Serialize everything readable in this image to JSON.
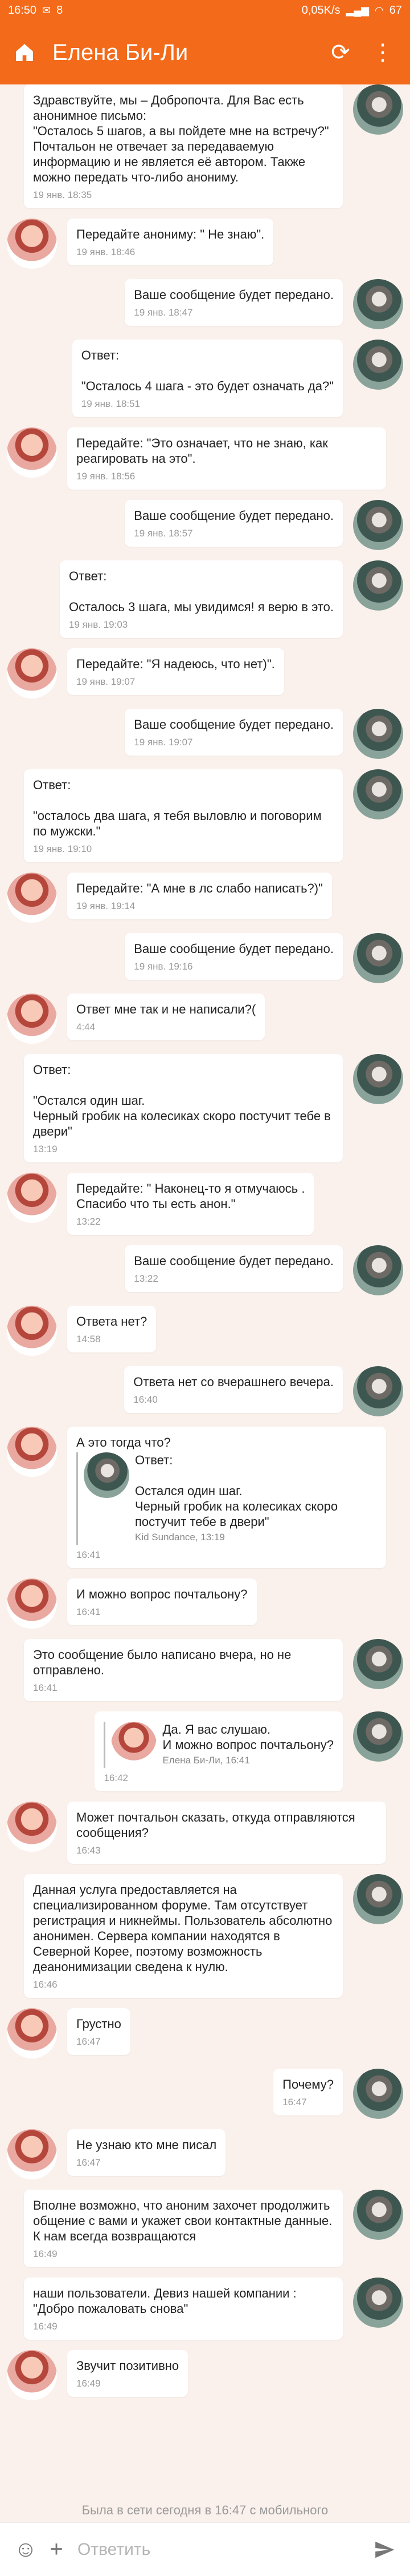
{
  "status": {
    "time": "16:50",
    "left_extra": "8",
    "speed": "0,05K/s",
    "battery": "67"
  },
  "header": {
    "title": "Елена Би-Ли"
  },
  "messages": [
    {
      "dir": "out",
      "text": "Здравствуйте, мы – Добропочта. Для Вас есть анонимное письмо:\n\"Осталось 5 шагов, а вы пойдете мне на встречу?\"\nПочтальон не отвечает за передаваемую информацию и не является её автором. Также можно передать что-либо анониму.",
      "time": "19 янв. 18:35"
    },
    {
      "dir": "in",
      "text": "Передайте анониму: \" Не знаю\".",
      "time": "19 янв. 18:46"
    },
    {
      "dir": "out",
      "text": "Ваше сообщение будет передано.",
      "time": "19 янв. 18:47"
    },
    {
      "dir": "out",
      "text": "Ответ:\n\n\"Осталось 4 шага - это будет означать да?\"",
      "time": "19 янв. 18:51"
    },
    {
      "dir": "in",
      "text": "Передайте: \"Это означает, что не знаю, как реагировать на это\".",
      "time": "19 янв. 18:56"
    },
    {
      "dir": "out",
      "text": "Ваше сообщение будет передано.",
      "time": "19 янв. 18:57"
    },
    {
      "dir": "out",
      "text": "Ответ:\n\nОсталось 3 шага, мы увидимся! я верю в это.",
      "time": "19 янв. 19:03"
    },
    {
      "dir": "in",
      "text": "Передайте: \"Я надеюсь, что нет)\".",
      "time": "19 янв. 19:07"
    },
    {
      "dir": "out",
      "text": "Ваше сообщение будет передано.",
      "time": "19 янв. 19:07"
    },
    {
      "dir": "out",
      "text": "Ответ:\n\n\"осталось два шага, я тебя выловлю и поговорим по мужски.\"",
      "time": "19 янв. 19:10"
    },
    {
      "dir": "in",
      "text": "Передайте: \"А мне в лс слабо написать?)\"",
      "time": "19 янв. 19:14"
    },
    {
      "dir": "out",
      "text": "Ваше сообщение будет передано.",
      "time": "19 янв. 19:16"
    },
    {
      "dir": "in",
      "text": "Ответ мне так и не написали?(",
      "time": "4:44"
    },
    {
      "dir": "out",
      "text": "Ответ:\n\n\"Остался один шаг.\nЧерный гробик на колесиках скоро постучит тебе в двери\"",
      "time": "13:19"
    },
    {
      "dir": "in",
      "text": "Передайте: \" Наконец-то я отмучаюсь .\nСпасибо что ты есть анон.\"",
      "time": "13:22"
    },
    {
      "dir": "out",
      "text": "Ваше сообщение будет передано.",
      "time": "13:22"
    },
    {
      "dir": "in",
      "text": "Ответа нет?",
      "time": "14:58"
    },
    {
      "dir": "out",
      "text": "Ответа нет со вчерашнего вечера.",
      "time": "16:40"
    },
    {
      "dir": "in",
      "text": "А это тогда что?",
      "time": "16:41",
      "quote": {
        "text": "Ответ:\n\nОстался один шаг.\nЧерный гробик на колесиках скоро постучит тебе в двери\"",
        "name": "Kid Sundance, 13:19",
        "avatar": "him"
      }
    },
    {
      "dir": "in",
      "text": "И можно вопрос почтальону?",
      "time": "16:41"
    },
    {
      "dir": "out",
      "text": "Это сообщение было написано вчера, но не отправлено.",
      "time": "16:41"
    },
    {
      "dir": "out",
      "text": "",
      "time": "16:42",
      "quote": {
        "text": "Да. Я вас слушаю.\nИ можно вопрос почтальону?",
        "name": "Елена Би-Ли, 16:41",
        "avatar": "her"
      }
    },
    {
      "dir": "in",
      "text": "Может почтальон сказать, откуда отправляются сообщения?",
      "time": "16:43"
    },
    {
      "dir": "out",
      "text": "Данная услуга предоставляется на специализированном форуме. Там отсутствует регистрация и никнеймы. Пользователь абсолютно анонимен. Сервера компании находятся в Северной Корее, поэтому возможность деанонимизации сведена к нулю.",
      "time": "16:46"
    },
    {
      "dir": "in",
      "text": "Грустно",
      "time": "16:47"
    },
    {
      "dir": "out",
      "text": "Почему?",
      "time": "16:47"
    },
    {
      "dir": "in",
      "text": "Не узнаю кто мне писал",
      "time": "16:47"
    },
    {
      "dir": "out",
      "text": "Вполне возможно, что аноним захочет продолжить общение с вами и укажет свои контактные данные. К нам всегда возвращаются",
      "time": "16:49"
    },
    {
      "dir": "out",
      "text": "наши пользователи. Девиз нашей компании : \"Добро пожаловать снова\"",
      "time": "16:49"
    },
    {
      "dir": "in",
      "text": "Звучит позитивно",
      "time": "16:49"
    }
  ],
  "online": "Была в сети сегодня в 16:47 с мобильного",
  "composer": {
    "placeholder": "Ответить"
  },
  "colors": {
    "accent": "#f36a1a",
    "background": "#fbf1ec"
  }
}
